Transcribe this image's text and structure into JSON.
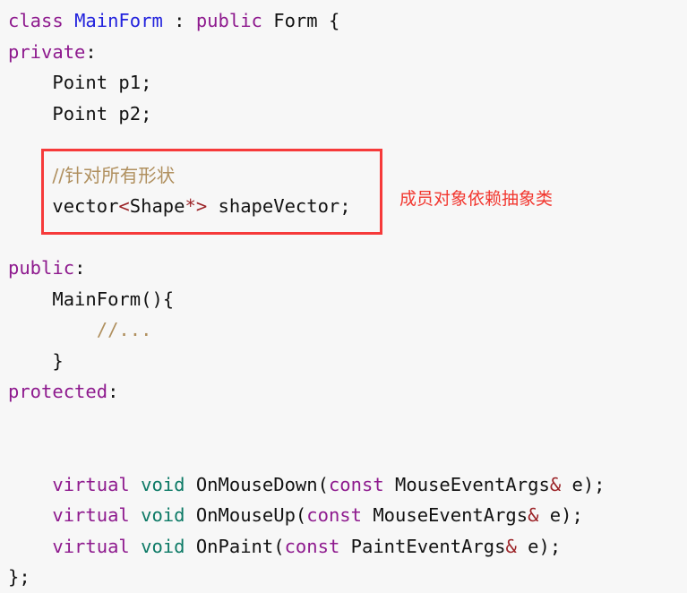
{
  "editor": {
    "background_color": "#f7f7f7",
    "default_text_color": "#121212",
    "language": "C++"
  },
  "palette": {
    "keyword_purple": "#8e1a8e",
    "classname_blue": "#2222dd",
    "void_teal": "#0d7a66",
    "operator_red": "#9b2226",
    "comment_tan": "#b0905f",
    "highlight_box_red": "#f63a3a",
    "annotation_red": "#f2372f"
  },
  "code": {
    "lines": [
      {
        "id": "line-1",
        "segments": [
          {
            "t": "class",
            "c": "kw"
          },
          {
            "t": " ",
            "c": "plain"
          },
          {
            "t": "MainForm",
            "c": "type-blue"
          },
          {
            "t": " : ",
            "c": "plain"
          },
          {
            "t": "public",
            "c": "kw"
          },
          {
            "t": " Form {",
            "c": "plain"
          }
        ]
      },
      {
        "id": "line-2",
        "segments": [
          {
            "t": "private",
            "c": "kw"
          },
          {
            "t": ":",
            "c": "plain"
          }
        ]
      },
      {
        "id": "line-3",
        "segments": [
          {
            "t": "    Point p1;",
            "c": "plain"
          }
        ]
      },
      {
        "id": "line-4",
        "segments": [
          {
            "t": "    Point p2;",
            "c": "plain"
          }
        ]
      },
      {
        "id": "line-5",
        "segments": [
          {
            "t": "",
            "c": "plain"
          }
        ]
      },
      {
        "id": "line-6",
        "segments": [
          {
            "t": "    ",
            "c": "plain"
          },
          {
            "t": "//针对所有形状",
            "c": "comment cjk"
          }
        ]
      },
      {
        "id": "line-7",
        "segments": [
          {
            "t": "    vector",
            "c": "plain"
          },
          {
            "t": "<",
            "c": "punc-red"
          },
          {
            "t": "Shape",
            "c": "plain"
          },
          {
            "t": "*>",
            "c": "punc-red"
          },
          {
            "t": " shapeVector;",
            "c": "plain"
          }
        ]
      },
      {
        "id": "line-8",
        "segments": [
          {
            "t": "",
            "c": "plain"
          }
        ]
      },
      {
        "id": "line-9",
        "segments": [
          {
            "t": "public",
            "c": "kw"
          },
          {
            "t": ":",
            "c": "plain"
          }
        ]
      },
      {
        "id": "line-10",
        "segments": [
          {
            "t": "    MainForm(){",
            "c": "plain"
          }
        ]
      },
      {
        "id": "line-11",
        "segments": [
          {
            "t": "        ",
            "c": "plain"
          },
          {
            "t": "//...",
            "c": "comment"
          }
        ]
      },
      {
        "id": "line-12",
        "segments": [
          {
            "t": "    }",
            "c": "plain"
          }
        ]
      },
      {
        "id": "line-13",
        "segments": [
          {
            "t": "protected",
            "c": "kw"
          },
          {
            "t": ":",
            "c": "plain"
          }
        ]
      },
      {
        "id": "line-14",
        "segments": [
          {
            "t": "",
            "c": "plain"
          }
        ]
      },
      {
        "id": "line-15",
        "segments": [
          {
            "t": "",
            "c": "plain"
          }
        ]
      },
      {
        "id": "line-16",
        "segments": [
          {
            "t": "    ",
            "c": "plain"
          },
          {
            "t": "virtual",
            "c": "kw"
          },
          {
            "t": " ",
            "c": "plain"
          },
          {
            "t": "void",
            "c": "kw-void"
          },
          {
            "t": " OnMouseDown(",
            "c": "plain"
          },
          {
            "t": "const",
            "c": "kw"
          },
          {
            "t": " MouseEventArgs",
            "c": "plain"
          },
          {
            "t": "&",
            "c": "punc-red"
          },
          {
            "t": " e);",
            "c": "plain"
          }
        ]
      },
      {
        "id": "line-17",
        "segments": [
          {
            "t": "    ",
            "c": "plain"
          },
          {
            "t": "virtual",
            "c": "kw"
          },
          {
            "t": " ",
            "c": "plain"
          },
          {
            "t": "void",
            "c": "kw-void"
          },
          {
            "t": " OnMouseUp(",
            "c": "plain"
          },
          {
            "t": "const",
            "c": "kw"
          },
          {
            "t": " MouseEventArgs",
            "c": "plain"
          },
          {
            "t": "&",
            "c": "punc-red"
          },
          {
            "t": " e);",
            "c": "plain"
          }
        ]
      },
      {
        "id": "line-18",
        "segments": [
          {
            "t": "    ",
            "c": "plain"
          },
          {
            "t": "virtual",
            "c": "kw"
          },
          {
            "t": " ",
            "c": "plain"
          },
          {
            "t": "void",
            "c": "kw-void"
          },
          {
            "t": " OnPaint(",
            "c": "plain"
          },
          {
            "t": "const",
            "c": "kw"
          },
          {
            "t": " PaintEventArgs",
            "c": "plain"
          },
          {
            "t": "&",
            "c": "punc-red"
          },
          {
            "t": " e);",
            "c": "plain"
          }
        ]
      },
      {
        "id": "line-19",
        "segments": [
          {
            "t": "};",
            "c": "plain"
          }
        ]
      }
    ]
  },
  "highlight_box": {
    "label": "vector-shape-member-highlight",
    "encloses_lines": [
      "line-6",
      "line-7"
    ]
  },
  "annotation": {
    "text": "成员对象依赖抽象类"
  }
}
